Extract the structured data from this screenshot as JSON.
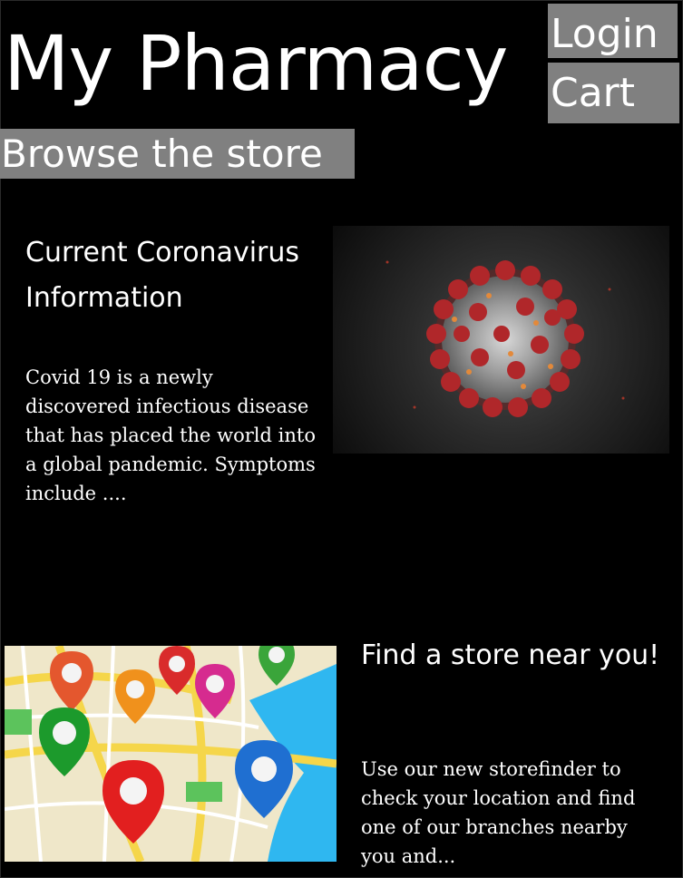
{
  "header": {
    "title": "My Pharmacy",
    "login_label": "Login",
    "cart_label": "Cart",
    "browse_label": "Browse the store"
  },
  "covid_section": {
    "heading": "Current Coronavirus Information",
    "body": "Covid 19 is a newly discovered  infectious disease that has placed the world into a global pandemic. Symptoms include ...."
  },
  "store_section": {
    "heading": "Find a store near you!",
    "body": "Use our new storefinder to check your location and find one of our branches nearby you and..."
  },
  "colors": {
    "background": "#000000",
    "button": "#808080",
    "text": "#ffffff"
  }
}
